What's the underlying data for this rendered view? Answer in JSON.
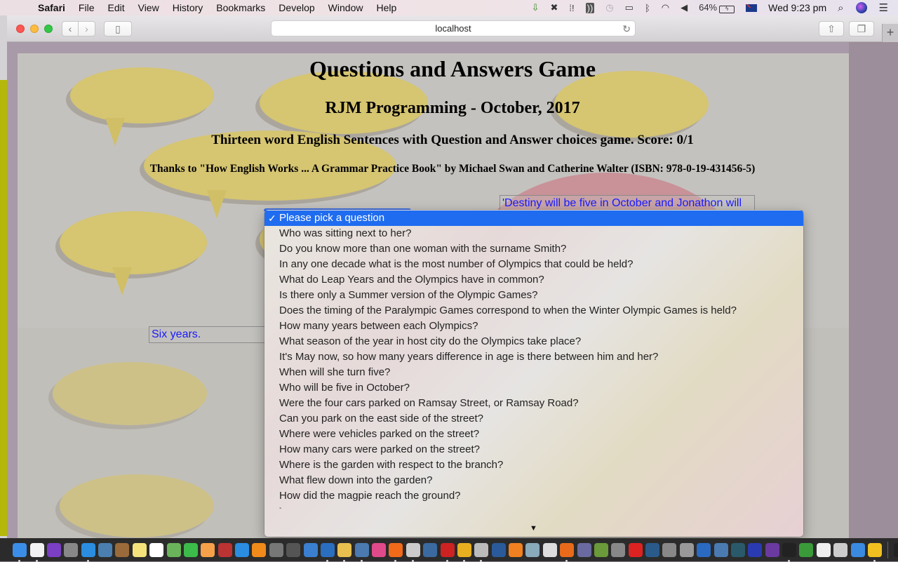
{
  "menubar": {
    "app_name": "Safari",
    "items": [
      "File",
      "Edit",
      "View",
      "History",
      "Bookmarks",
      "Develop",
      "Window",
      "Help"
    ],
    "battery": "64%",
    "clock": "Wed 9:23 pm",
    "status_icons": [
      "download-icon",
      "avast-icon",
      "grid-icon",
      "sound-icon",
      "time-machine-icon",
      "airplay-icon",
      "bluetooth-icon",
      "wifi-icon",
      "volume-icon",
      "battery-icon",
      "flag-icon",
      "spotlight-icon",
      "siri-icon",
      "notification-center-icon"
    ]
  },
  "browser": {
    "url": "localhost",
    "new_tab_label": "+"
  },
  "page": {
    "title": "Questions and Answers Game",
    "subtitle": "RJM Programming - October, 2017",
    "description": "Thirteen word English Sentences with Question and Answer choices game. Score: 0/1",
    "credits": "Thanks to \"How English Works ... A Grammar Practice Book\" by Michael Swan and Catherine Walter (ISBN: 978-0-19-431456-5)",
    "sentence_box": "'Destiny will be five in October and Jonathon will",
    "answer_box": "Six years."
  },
  "question_select": {
    "selected": "Please pick a question",
    "options": [
      "Please pick a question",
      "Who was sitting next to her?",
      "Do you know more than one woman with the surname Smith?",
      "In any one decade what is the most number of Olympics that could be held?",
      "What do Leap Years and the Olympics have in common?",
      "Is there only a Summer version of the Olympic Games?",
      "Does the timing of the Paralympic Games correspond to when the Winter Olympic Games is held?",
      "How many years between each Olympics?",
      "What season of the year in host city do the Olympics take place?",
      "It's May now, so how many years difference in age is there between him and her?",
      "When will she turn five?",
      "Who will be five in October?",
      "Were the four cars parked on Ramsay Street, or Ramsay Road?",
      "Can you park on the east side of the street?",
      "Where were vehicles parked on the street?",
      "How many cars were parked on the street?",
      "Where is the garden with respect to the branch?",
      "What flew down into the garden?",
      "How did the magpie reach the ground?"
    ],
    "check_glyph": "✓",
    "scroll_more_glyph": "▼"
  },
  "colors": {
    "selection": "#1f6cf0",
    "answer_text": "#1a1aff"
  },
  "dock": {
    "apps": [
      "Finder",
      "TextEdit",
      "Siri",
      "Launchpad",
      "Safari",
      "Preview",
      "Contacts",
      "Notes",
      "Calendar",
      "Maps",
      "FaceTime",
      "Photos",
      "Photo Booth",
      "App Store",
      "iBooks",
      "System Preferences",
      "GIMP",
      "Xcode",
      "WordService",
      "Paintbrush",
      "Image Capture",
      "iTunes",
      "Avast",
      "Clipboard",
      "Screen Sharing",
      "FileZilla",
      "Chrome",
      "Mind Map",
      "QuickTime",
      "VLC",
      "Sketchup",
      "TextWrangler",
      "Firefox",
      "PHP",
      "Android Studio",
      "Help",
      "Opera",
      "VirtualBox",
      "Help 2",
      "Keychain Access",
      "Visual Studio Code",
      "Photos Library",
      "Network",
      "Bird",
      "GitHub",
      "Terminal",
      "Marbles",
      "Drop",
      "Instruments",
      "Simulator",
      "Keychain",
      "Desktop",
      "Document",
      "Trash"
    ]
  }
}
